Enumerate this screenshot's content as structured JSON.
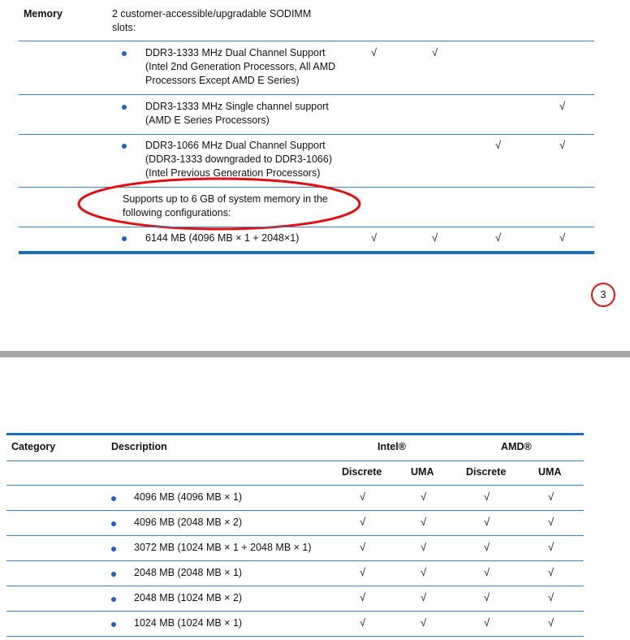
{
  "top_table": {
    "category": "Memory",
    "slots_text": [
      "2 customer-accessible/upgradable SODIMM",
      "slots:"
    ],
    "rows": [
      {
        "lines": [
          "DDR3-1333 MHz Dual Channel Support",
          "(Intel 2nd Generation Processors, All AMD",
          "Processors Except AMD E Series)"
        ],
        "checks": [
          "√",
          "√",
          "",
          ""
        ]
      },
      {
        "lines": [
          "DDR3-1333 MHz Single channel support",
          "(AMD E Series Processors)"
        ],
        "checks": [
          "",
          "",
          "",
          "√"
        ]
      },
      {
        "lines": [
          "DDR3-1066 MHz Dual Channel Support",
          "(DDR3-1333 downgraded to DDR3-1066)",
          "(Intel Previous Generation Processors)"
        ],
        "checks": [
          "",
          "",
          "√",
          "√"
        ]
      }
    ],
    "supports_text": [
      "Supports up to 6 GB of system memory in the",
      "following configurations:"
    ],
    "last_row": {
      "label": "6144 MB (4096 MB × 1 + 2048×1)",
      "checks": [
        "√",
        "√",
        "√",
        "√"
      ]
    }
  },
  "page_number": "3",
  "bottom_table": {
    "headers": {
      "category": "Category",
      "description": "Description",
      "intel": "Intel®",
      "amd": "AMD®",
      "discrete1": "Discrete",
      "uma1": "UMA",
      "discrete2": "Discrete",
      "uma2": "UMA"
    },
    "rows": [
      {
        "label": "4096 MB (4096 MB × 1)",
        "checks": [
          "√",
          "√",
          "√",
          "√"
        ]
      },
      {
        "label": "4096 MB (2048 MB × 2)",
        "checks": [
          "√",
          "√",
          "√",
          "√"
        ]
      },
      {
        "label": "3072 MB (1024 MB × 1 + 2048 MB × 1)",
        "checks": [
          "√",
          "√",
          "√",
          "√"
        ]
      },
      {
        "label": "2048 MB (2048 MB × 1)",
        "checks": [
          "√",
          "√",
          "√",
          "√"
        ]
      },
      {
        "label": "2048 MB (1024 MB × 2)",
        "checks": [
          "√",
          "√",
          "√",
          "√"
        ]
      },
      {
        "label": "1024 MB (1024 MB × 1)",
        "checks": [
          "√",
          "√",
          "√",
          "√"
        ]
      }
    ]
  },
  "colors": {
    "rule": "#3b82c4",
    "thick_rule": "#1f6fc0",
    "annotation": "#e01010",
    "separator": "#a8a8a8"
  }
}
